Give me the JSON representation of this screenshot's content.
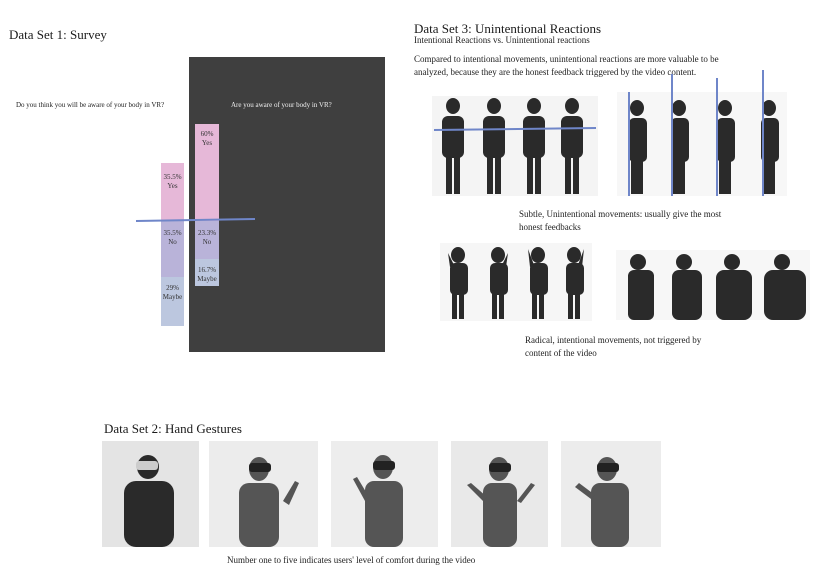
{
  "dataset1": {
    "title": "Data Set 1: Survey",
    "question1": "Do you think you will be aware of your body in VR?",
    "question2": "Are you aware of your body in VR?",
    "bars_left": [
      {
        "value": "35.5%",
        "label": "Yes",
        "color": "#e6b8d8"
      },
      {
        "value": "35.5%",
        "label": "No",
        "color": "#b9b3d9"
      },
      {
        "value": "29%",
        "label": "Maybe",
        "color": "#bcc7df"
      }
    ],
    "bars_right": [
      {
        "value": "60%",
        "label": "Yes",
        "color": "#e6b8d8"
      },
      {
        "value": "23.3%",
        "label": "No",
        "color": "#b9b3d9"
      },
      {
        "value": "16.7%",
        "label": "Maybe",
        "color": "#bcc7df"
      }
    ],
    "panel_color": "#3f3f3f",
    "line_color": "#6f86c9"
  },
  "dataset3": {
    "title": "Data Set 3: Unintentional Reactions",
    "subtitle": "Intentional Reactions vs. Unintentional reactions",
    "description": "Compared to intentional movements, unintentional reactions are more valuable to be analyzed, because they are the honest feedback triggered by the video content.",
    "caption1": "Subtle, Unintentional movements: usually give the most honest feedbacks",
    "caption2": "Radical, intentional movements, not triggered by content of the video"
  },
  "dataset2": {
    "title": "Data Set 2: Hand Gestures",
    "caption": "Number one to five indicates users' level of comfort during the video"
  }
}
